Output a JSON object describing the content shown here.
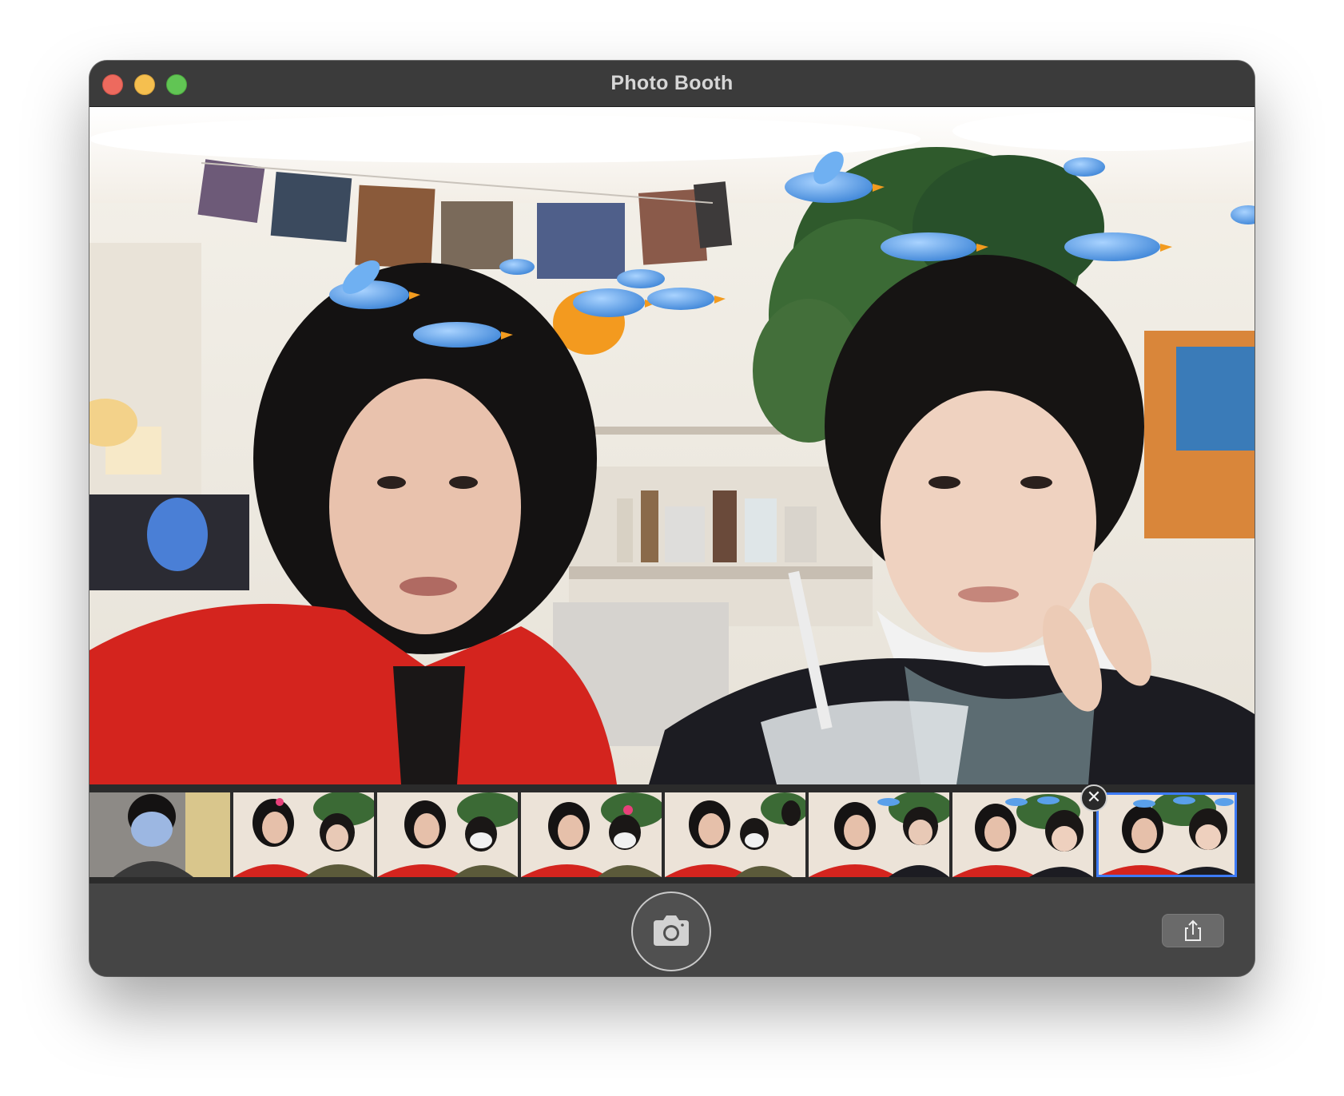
{
  "window": {
    "title": "Photo Booth"
  },
  "preview": {
    "effect": "birds-overhead"
  },
  "filmstrip": {
    "count": 8,
    "selected_index": 7,
    "delete_badge": "✕"
  },
  "toolbar": {
    "shutter_icon": "camera-icon",
    "share_icon": "share-icon"
  },
  "colors": {
    "titlebar": "#3b3b3b",
    "toolbar": "#454545",
    "selection": "#3d7bf7",
    "close": "#ed6a5e",
    "minimize": "#f5bf4f",
    "maximize": "#61c554"
  }
}
